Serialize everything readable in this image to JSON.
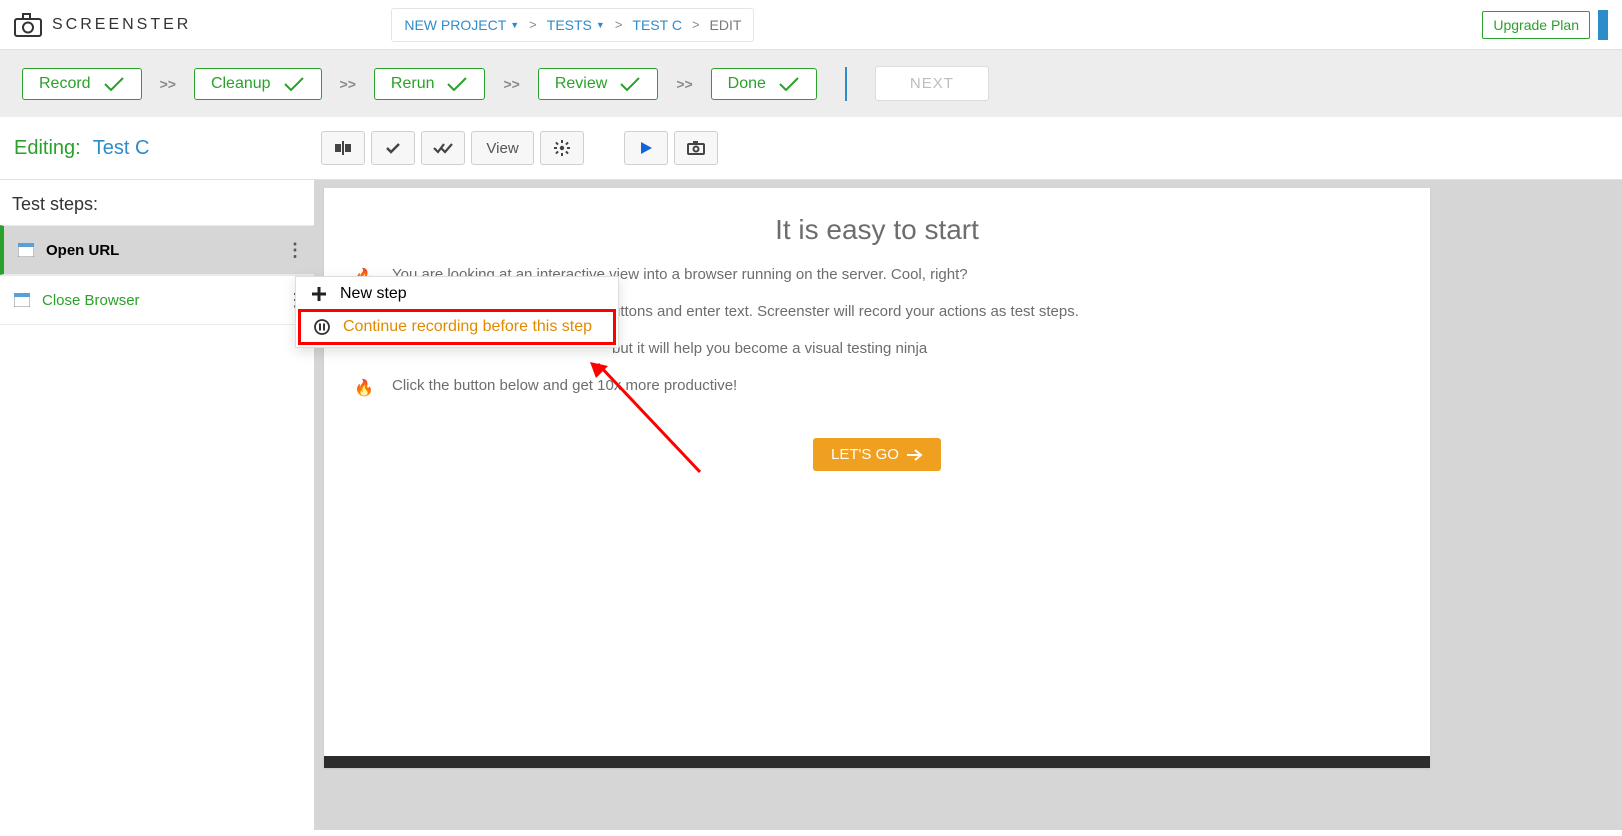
{
  "header": {
    "brand": "SCREENSTER",
    "breadcrumb": {
      "project": "NEW PROJECT",
      "tests": "TESTS",
      "test": "TEST C",
      "current": "EDIT"
    },
    "upgrade": "Upgrade Plan"
  },
  "workflow": {
    "steps": [
      "Record",
      "Cleanup",
      "Rerun",
      "Review",
      "Done"
    ],
    "next": "NEXT"
  },
  "editing": {
    "label": "Editing:",
    "name": "Test C",
    "view_btn": "View"
  },
  "sidebar": {
    "title": "Test steps:",
    "items": [
      {
        "label": "Open URL"
      },
      {
        "label": "Close Browser"
      }
    ]
  },
  "context_menu": {
    "new_step": "New step",
    "continue_rec": "Continue recording before this step"
  },
  "content": {
    "title": "It is easy to start",
    "bullets": [
      "You are looking at an interactive view into a browser running on the server. Cool, right?",
      "uttons and enter text. Screenster will record your actions as test steps.",
      "but it will help you become a visual testing ninja",
      "Click the button below and get 10x more productive!"
    ],
    "go_btn": "LET'S GO"
  }
}
